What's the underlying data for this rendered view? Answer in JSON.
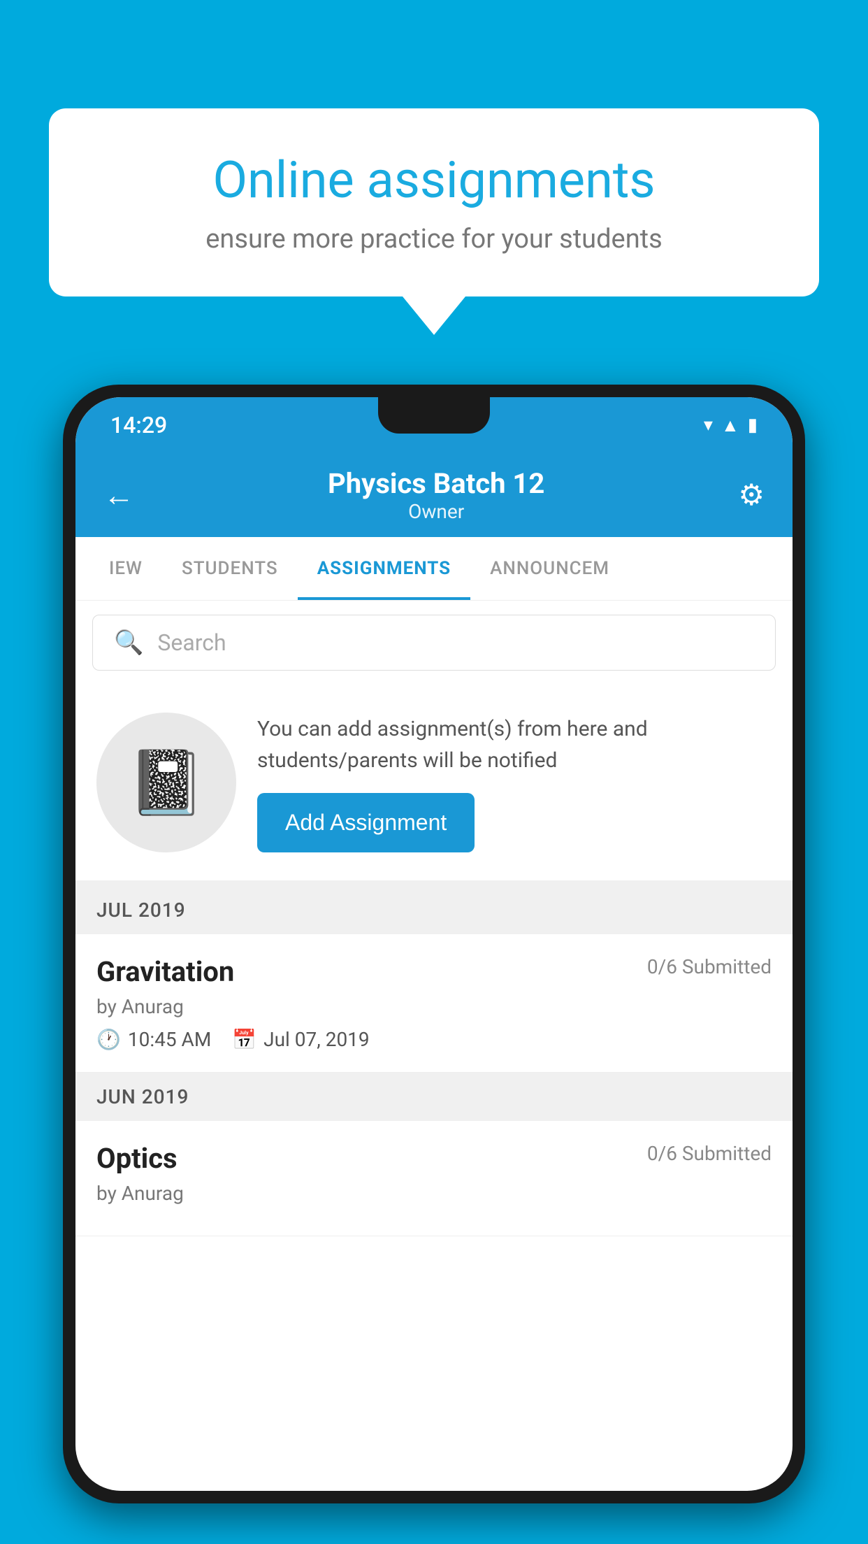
{
  "background_color": "#00AADD",
  "speech_bubble": {
    "title": "Online assignments",
    "subtitle": "ensure more practice for your students"
  },
  "status_bar": {
    "time": "14:29",
    "icons": [
      "wifi",
      "signal",
      "battery"
    ]
  },
  "app_header": {
    "title": "Physics Batch 12",
    "subtitle": "Owner",
    "back_label": "←",
    "gear_label": "⚙"
  },
  "tabs": [
    {
      "label": "IEW",
      "active": false
    },
    {
      "label": "STUDENTS",
      "active": false
    },
    {
      "label": "ASSIGNMENTS",
      "active": true
    },
    {
      "label": "ANNOUNCEM",
      "active": false
    }
  ],
  "search": {
    "placeholder": "Search"
  },
  "assignment_prompt": {
    "description": "You can add assignment(s) from here and students/parents will be notified",
    "button_label": "Add Assignment"
  },
  "sections": [
    {
      "header": "JUL 2019",
      "assignments": [
        {
          "name": "Gravitation",
          "submitted": "0/6 Submitted",
          "by": "by Anurag",
          "time": "10:45 AM",
          "date": "Jul 07, 2019"
        }
      ]
    },
    {
      "header": "JUN 2019",
      "assignments": [
        {
          "name": "Optics",
          "submitted": "0/6 Submitted",
          "by": "by Anurag",
          "time": "",
          "date": ""
        }
      ]
    }
  ]
}
